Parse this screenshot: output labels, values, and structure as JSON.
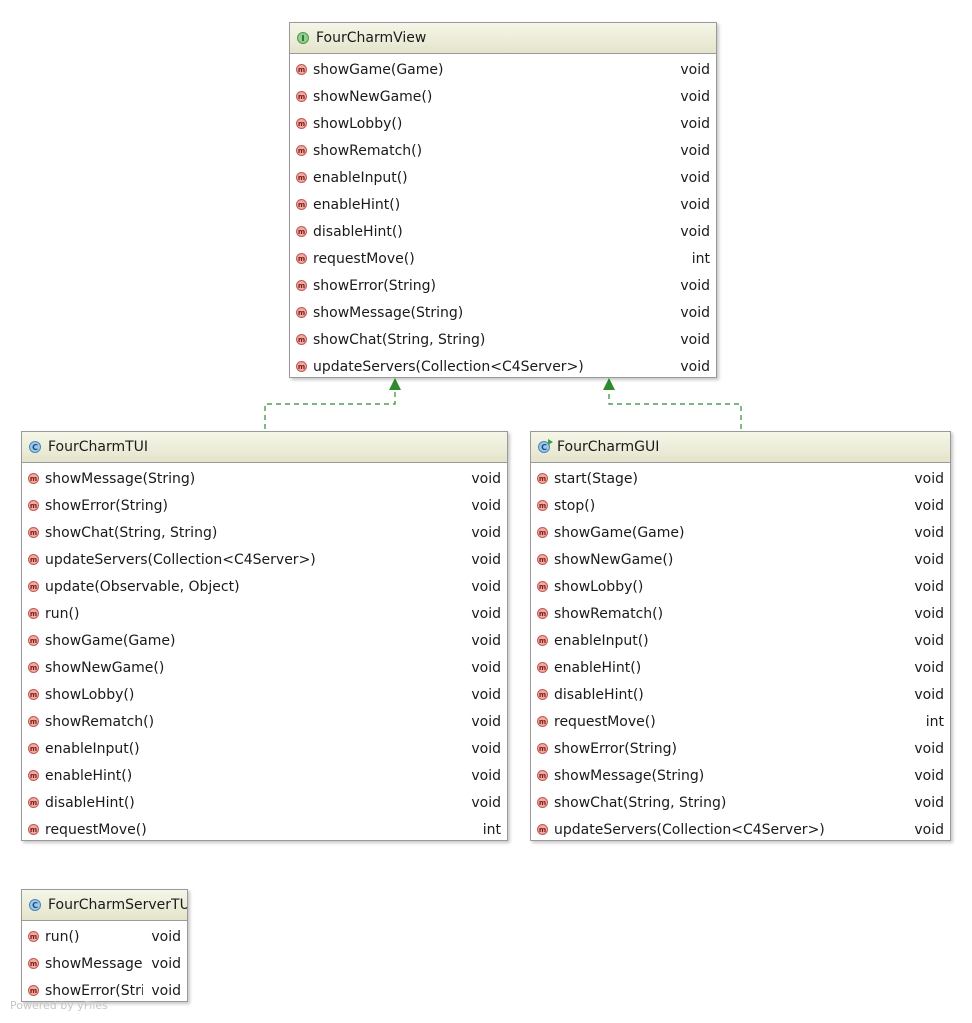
{
  "classes": {
    "view": {
      "kind_badge": "I",
      "name": "FourCharmView",
      "methods": [
        {
          "icon": "m",
          "sig": "showGame(Game)",
          "ret": "void"
        },
        {
          "icon": "m",
          "sig": "showNewGame()",
          "ret": "void"
        },
        {
          "icon": "m",
          "sig": "showLobby()",
          "ret": "void"
        },
        {
          "icon": "m",
          "sig": "showRematch()",
          "ret": "void"
        },
        {
          "icon": "m",
          "sig": "enableInput()",
          "ret": "void"
        },
        {
          "icon": "m",
          "sig": "enableHint()",
          "ret": "void"
        },
        {
          "icon": "m",
          "sig": "disableHint()",
          "ret": "void"
        },
        {
          "icon": "m",
          "sig": "requestMove()",
          "ret": "int"
        },
        {
          "icon": "m",
          "sig": "showError(String)",
          "ret": "void"
        },
        {
          "icon": "m",
          "sig": "showMessage(String)",
          "ret": "void"
        },
        {
          "icon": "m",
          "sig": "showChat(String, String)",
          "ret": "void"
        },
        {
          "icon": "m",
          "sig": "updateServers(Collection<C4Server>)",
          "ret": "void"
        }
      ]
    },
    "tui": {
      "kind_badge": "C",
      "name": "FourCharmTUI",
      "methods": [
        {
          "icon": "m",
          "sig": "showMessage(String)",
          "ret": "void"
        },
        {
          "icon": "m",
          "sig": "showError(String)",
          "ret": "void"
        },
        {
          "icon": "m",
          "sig": "showChat(String, String)",
          "ret": "void"
        },
        {
          "icon": "m",
          "sig": "updateServers(Collection<C4Server>)",
          "ret": "void"
        },
        {
          "icon": "m",
          "sig": "update(Observable, Object)",
          "ret": "void"
        },
        {
          "icon": "m",
          "sig": "run()",
          "ret": "void"
        },
        {
          "icon": "m",
          "sig": "showGame(Game)",
          "ret": "void"
        },
        {
          "icon": "m",
          "sig": "showNewGame()",
          "ret": "void"
        },
        {
          "icon": "m",
          "sig": "showLobby()",
          "ret": "void"
        },
        {
          "icon": "m",
          "sig": "showRematch()",
          "ret": "void"
        },
        {
          "icon": "m",
          "sig": "enableInput()",
          "ret": "void"
        },
        {
          "icon": "m",
          "sig": "enableHint()",
          "ret": "void"
        },
        {
          "icon": "m",
          "sig": "disableHint()",
          "ret": "void"
        },
        {
          "icon": "m",
          "sig": "requestMove()",
          "ret": "int"
        }
      ]
    },
    "gui": {
      "kind_badge": "C",
      "name": "FourCharmGUI",
      "methods": [
        {
          "icon": "m",
          "sig": "start(Stage)",
          "ret": "void"
        },
        {
          "icon": "m",
          "sig": "stop()",
          "ret": "void"
        },
        {
          "icon": "m",
          "sig": "showGame(Game)",
          "ret": "void"
        },
        {
          "icon": "m",
          "sig": "showNewGame()",
          "ret": "void"
        },
        {
          "icon": "m",
          "sig": "showLobby()",
          "ret": "void"
        },
        {
          "icon": "m",
          "sig": "showRematch()",
          "ret": "void"
        },
        {
          "icon": "m",
          "sig": "enableInput()",
          "ret": "void"
        },
        {
          "icon": "m",
          "sig": "enableHint()",
          "ret": "void"
        },
        {
          "icon": "m",
          "sig": "disableHint()",
          "ret": "void"
        },
        {
          "icon": "m",
          "sig": "requestMove()",
          "ret": "int"
        },
        {
          "icon": "m",
          "sig": "showError(String)",
          "ret": "void"
        },
        {
          "icon": "m",
          "sig": "showMessage(String)",
          "ret": "void"
        },
        {
          "icon": "m",
          "sig": "showChat(String, String)",
          "ret": "void"
        },
        {
          "icon": "m",
          "sig": "updateServers(Collection<C4Server>)",
          "ret": "void"
        }
      ]
    },
    "server_tui": {
      "kind_badge": "C",
      "name": "FourCharmServerTUI",
      "methods": [
        {
          "icon": "m",
          "sig": "run()",
          "ret": "void"
        },
        {
          "icon": "m",
          "sig": "showMessage(String)",
          "ret": "void"
        },
        {
          "icon": "m",
          "sig": "showError(String)",
          "ret": "void"
        }
      ]
    }
  },
  "relations": [
    {
      "from": "FourCharmTUI",
      "to": "FourCharmView",
      "type": "realization"
    },
    {
      "from": "FourCharmGUI",
      "to": "FourCharmView",
      "type": "realization"
    }
  ],
  "colors": {
    "header_top": "#f6f6e8",
    "header_bottom": "#e4e4cc",
    "interface_badge": "#8fcf8f",
    "class_badge": "#9cc8ea",
    "method_badge": "#f1aaa3",
    "realization_line": "#2e8b2e"
  },
  "watermark": "Powered by yFiles"
}
